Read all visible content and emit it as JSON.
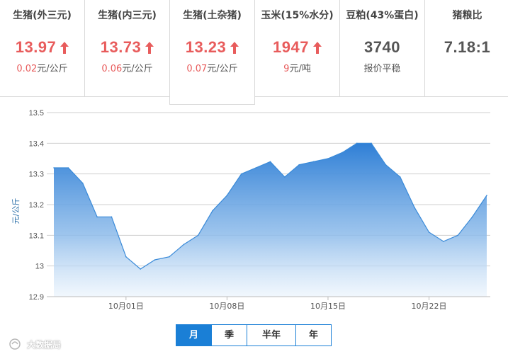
{
  "cards": [
    {
      "title": "生猪(外三元)",
      "price": "13.97",
      "trend": "up",
      "change_value": "0.02",
      "change_unit": "元/公斤"
    },
    {
      "title": "生猪(内三元)",
      "price": "13.73",
      "trend": "up",
      "change_value": "0.06",
      "change_unit": "元/公斤"
    },
    {
      "title": "生猪(土杂猪)",
      "price": "13.23",
      "trend": "up",
      "change_value": "0.07",
      "change_unit": "元/公斤"
    },
    {
      "title": "玉米(15%水分)",
      "price": "1947",
      "trend": "up",
      "change_value": "9",
      "change_unit": "元/吨"
    },
    {
      "title": "豆粕(43%蛋白)",
      "price": "3740",
      "trend": "flat",
      "change_text": "报价平稳"
    },
    {
      "title": "猪粮比",
      "price": "7.18:1",
      "trend": "none"
    }
  ],
  "active_card": 2,
  "colors": {
    "accent": "#1a7fd6",
    "up": "#e85c5c",
    "line": "#3a8ad8"
  },
  "chart_data": {
    "type": "area",
    "ylabel": "元/公斤",
    "ylim": [
      12.9,
      13.5
    ],
    "yticks": [
      "13.5",
      "13.4",
      "13.3",
      "13.2",
      "13.1",
      "13",
      "12.9"
    ],
    "xtick_labels": [
      "10月01日",
      "10月08日",
      "10月15日",
      "10月22日"
    ],
    "xtick_positions": [
      6,
      13,
      20,
      27
    ],
    "grid": true,
    "series": [
      {
        "x": [
          1,
          2,
          3,
          4,
          5,
          6,
          7,
          8,
          9,
          10,
          11,
          12,
          13,
          14,
          15,
          16,
          17,
          18,
          19,
          20,
          21,
          22,
          23,
          24,
          25,
          26,
          27,
          28,
          29,
          30,
          31
        ],
        "values": [
          13.32,
          13.32,
          13.27,
          13.16,
          13.16,
          13.03,
          12.99,
          13.02,
          13.03,
          13.07,
          13.1,
          13.18,
          13.23,
          13.3,
          13.32,
          13.34,
          13.29,
          13.33,
          13.34,
          13.35,
          13.37,
          13.4,
          13.4,
          13.33,
          13.29,
          13.19,
          13.11,
          13.08,
          13.1,
          13.16,
          13.23
        ]
      }
    ]
  },
  "tabs": {
    "items": [
      "月",
      "季",
      "半年",
      "年"
    ],
    "active": 0
  },
  "watermark": {
    "text": "大数据局"
  }
}
